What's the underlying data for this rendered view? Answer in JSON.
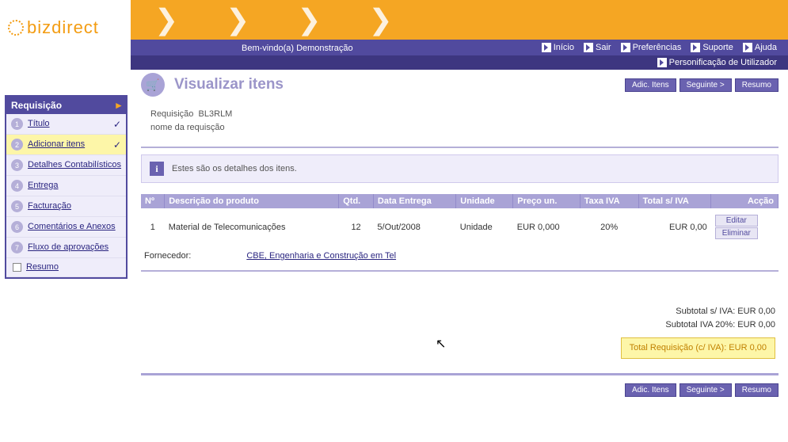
{
  "brand": "bizdirect",
  "welcome": "Bem-vindo(a) Demonstração",
  "topnav": {
    "inicio": "Início",
    "sair": "Sair",
    "preferencias": "Preferências",
    "suporte": "Suporte",
    "ajuda": "Ajuda",
    "personificacao": "Personificação de Utilizador"
  },
  "sidebar": {
    "title": "Requisição",
    "steps": [
      {
        "num": "1",
        "label": "Título"
      },
      {
        "num": "2",
        "label": "Adicionar itens"
      },
      {
        "num": "3",
        "label": "Detalhes Contabilísticos"
      },
      {
        "num": "4",
        "label": "Entrega"
      },
      {
        "num": "5",
        "label": "Facturação"
      },
      {
        "num": "6",
        "label": "Comentários e Anexos"
      },
      {
        "num": "7",
        "label": "Fluxo de aprovações"
      }
    ],
    "resumo": "Resumo"
  },
  "page": {
    "title": "Visualizar itens",
    "req_label": "Requisição",
    "req_id": "BL3RLM",
    "req_name": "nome da requisção",
    "info_msg": "Estes são os detalhes dos itens."
  },
  "buttons": {
    "adic": "Adic. Itens",
    "seguinte": "Seguinte >",
    "resumo": "Resumo",
    "editar": "Editar",
    "eliminar": "Eliminar"
  },
  "table": {
    "headers": {
      "no": "Nº",
      "desc": "Descrição do produto",
      "qtd": "Qtd.",
      "data": "Data Entrega",
      "unidade": "Unidade",
      "preco": "Preço un.",
      "taxa": "Taxa IVA",
      "total": "Total s/ IVA",
      "accao": "Acção"
    },
    "rows": [
      {
        "no": "1",
        "desc": "Material de Telecomunicações",
        "qtd": "12",
        "data": "5/Out/2008",
        "unidade": "Unidade",
        "preco": "EUR 0,000",
        "taxa": "20%",
        "total": "EUR 0,00"
      }
    ]
  },
  "supplier": {
    "label": "Fornecedor:",
    "name": "CBE, Engenharia e Construção em Tel"
  },
  "totals": {
    "subtotal": "Subtotal s/ IVA: EUR 0,00",
    "subtotal_iva": "Subtotal IVA 20%: EUR 0,00",
    "total": "Total Requisição (c/ IVA): EUR 0,00"
  }
}
